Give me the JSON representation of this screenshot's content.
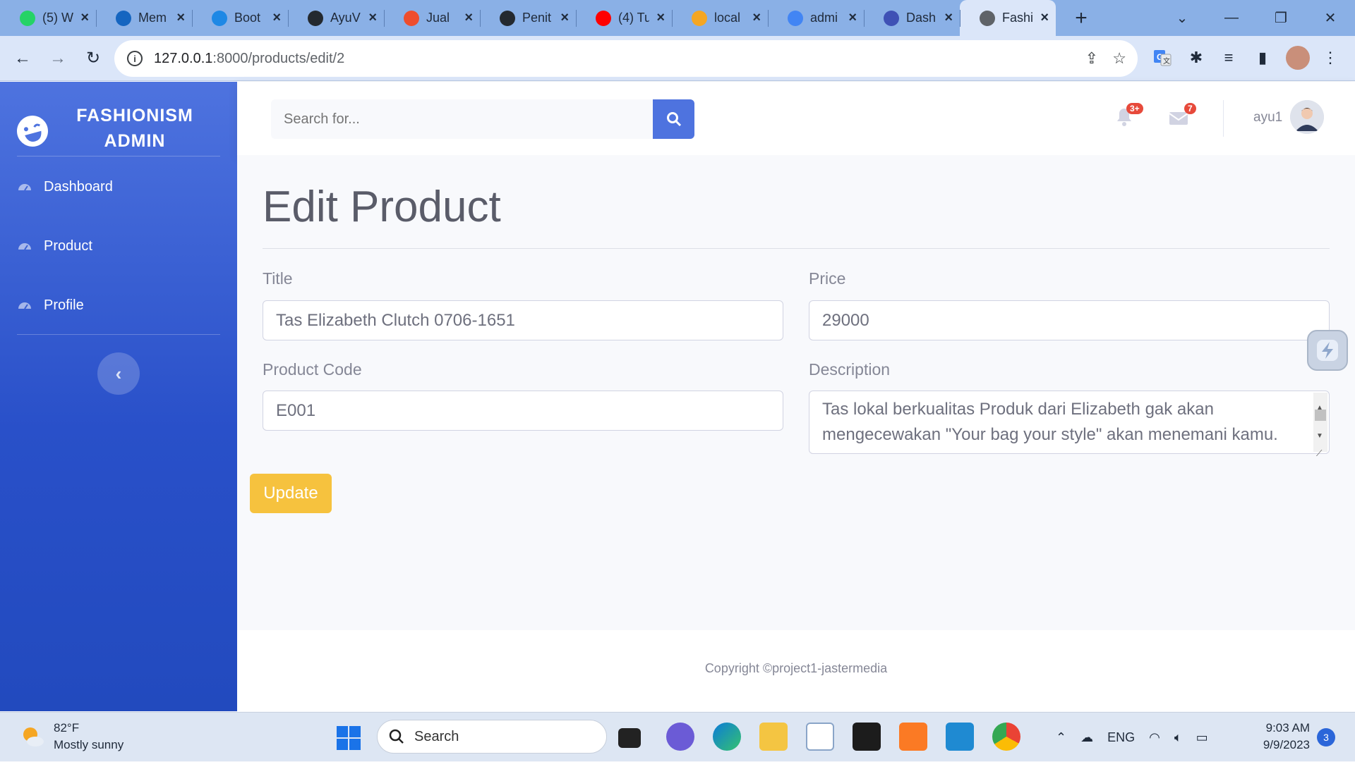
{
  "browser": {
    "tabs": [
      {
        "label": "(5) W",
        "icon": "whatsapp-icon",
        "color": "#25d366"
      },
      {
        "label": "Mem",
        "icon": "diamond-icon",
        "color": "#1565c0"
      },
      {
        "label": "Boot",
        "icon": "bolt-icon",
        "color": "#1e88e5"
      },
      {
        "label": "AyuV",
        "icon": "github-icon",
        "color": "#24292f"
      },
      {
        "label": "Jual",
        "icon": "shopee-icon",
        "color": "#ee4d2d"
      },
      {
        "label": "Penit",
        "icon": "github-icon",
        "color": "#24292f"
      },
      {
        "label": "(4) Tu",
        "icon": "youtube-icon",
        "color": "#ff0000"
      },
      {
        "label": "local",
        "icon": "phpmyadmin-icon",
        "color": "#f5a623"
      },
      {
        "label": "admi",
        "icon": "google-icon",
        "color": "#4285f4"
      },
      {
        "label": "Dash",
        "icon": "dashboard-icon",
        "color": "#3f51b5"
      },
      {
        "label": "Fashi",
        "icon": "globe-icon",
        "color": "#5f6368",
        "active": true
      }
    ],
    "url_host": "127.0.0.1",
    "url_path": ":8000/products/edit/2"
  },
  "sidebar": {
    "brand": "FASHIONISM ADMIN",
    "items": [
      {
        "label": "Dashboard"
      },
      {
        "label": "Product"
      },
      {
        "label": "Profile"
      }
    ]
  },
  "topbar": {
    "search_placeholder": "Search for...",
    "alerts_badge": "3+",
    "messages_badge": "7",
    "username": "ayu1"
  },
  "page": {
    "title": "Edit Product",
    "fields": {
      "title_label": "Title",
      "title_value": "Tas Elizabeth Clutch 0706-1651",
      "price_label": "Price",
      "price_value": "29000",
      "code_label": "Product Code",
      "code_value": "E001",
      "desc_label": "Description",
      "desc_value": "Tas lokal berkualitas Produk dari Elizabeth gak akan mengecewakan \"Your bag your style\" akan menemani kamu."
    },
    "update_label": "Update"
  },
  "footer": {
    "copyright": "Copyright ©project1-jastermedia"
  },
  "taskbar": {
    "temperature": "82°F",
    "weather": "Mostly sunny",
    "search_label": "Search",
    "language": "ENG",
    "time": "9:03 AM",
    "date": "9/9/2023",
    "notifications": "3"
  },
  "colors": {
    "primary": "#4e73df",
    "warning": "#f6c23e",
    "danger": "#e74a3b"
  }
}
